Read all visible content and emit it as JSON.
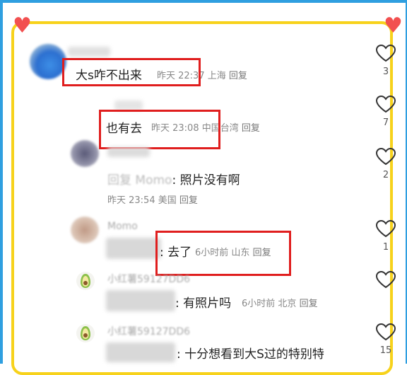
{
  "comments": [
    {
      "text": "大s咋不出来",
      "time": "昨天 22:37",
      "location": "上海",
      "reply_label": "回复",
      "likes": "3"
    },
    {
      "text": "也有去",
      "time": "昨天 23:08",
      "location": "中国台湾",
      "reply_label": "回复",
      "likes": "7"
    },
    {
      "reply_prefix": "回复",
      "reply_target": "Momo",
      "text": ": 照片没有啊",
      "time": "昨天 23:54",
      "location": "美国",
      "reply_label": "回复",
      "likes": "2"
    },
    {
      "username": "Momo",
      "text": ": 去了",
      "time": "6小时前",
      "location": "山东",
      "reply_label": "回复",
      "likes": "1"
    },
    {
      "username": "小红薯59127DD6",
      "text": ": 有照片吗",
      "time": "6小时前",
      "location": "北京",
      "reply_label": "回复",
      "likes": ""
    },
    {
      "username": "小红薯59127DD6",
      "text": ": 十分想看到大S过的特别特",
      "likes": "15"
    }
  ],
  "colors": {
    "highlight_box": "#e01e1e",
    "frame_outer": "#2f9fe0",
    "frame_inner": "#f7d21b"
  }
}
